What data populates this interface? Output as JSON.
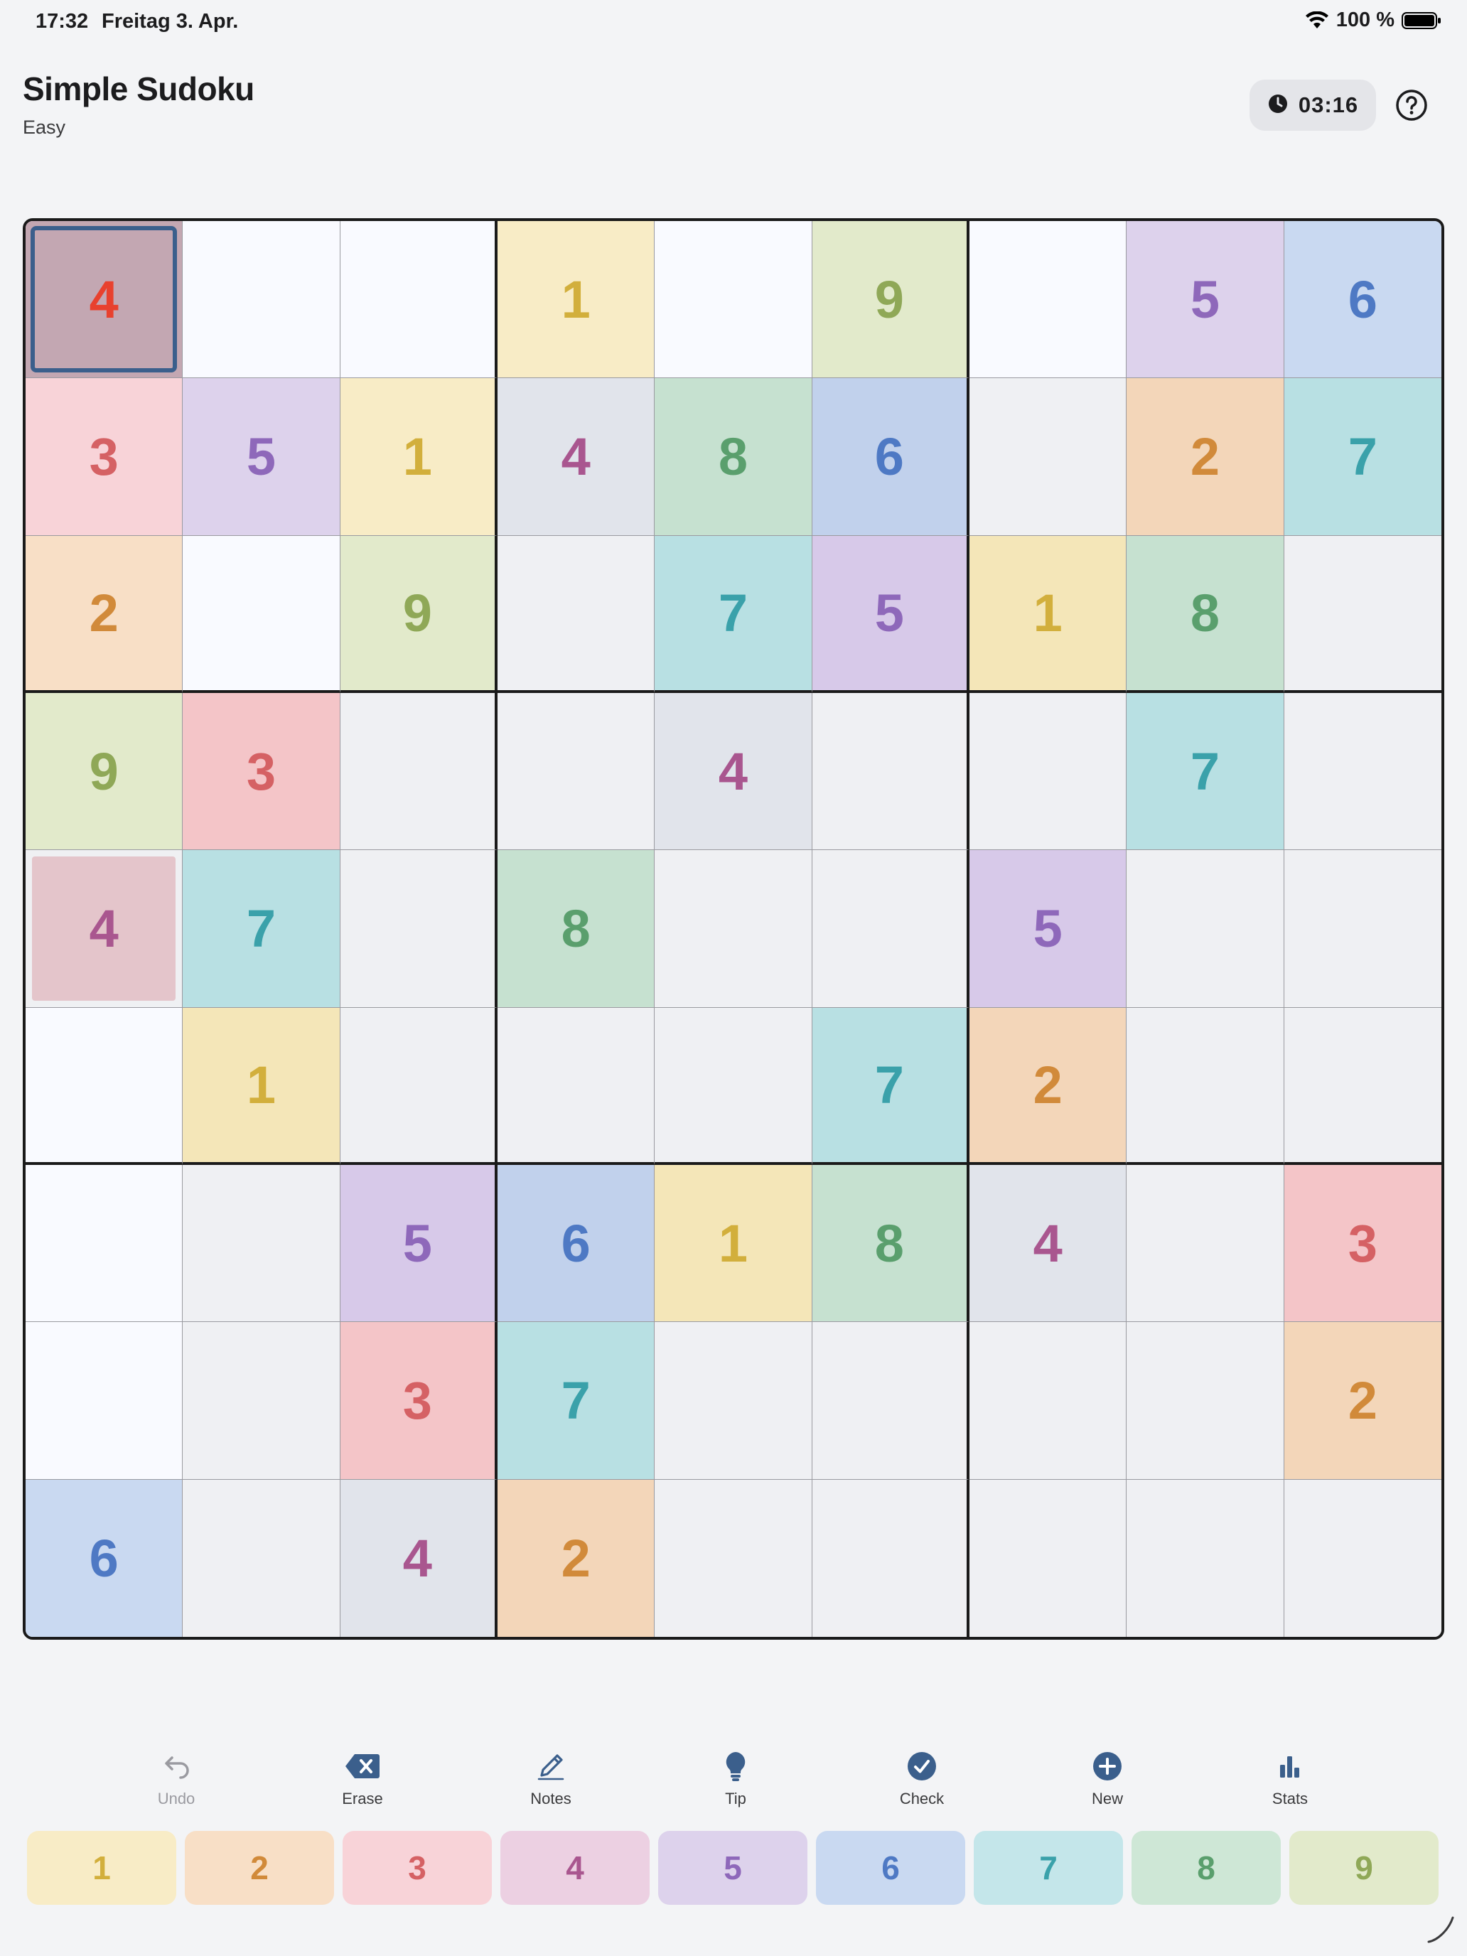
{
  "status_bar": {
    "time": "17:32",
    "date": "Freitag 3. Apr.",
    "battery": "100 %"
  },
  "header": {
    "title": "Simple Sudoku",
    "difficulty": "Easy",
    "timer": "03:16"
  },
  "board": {
    "cells": [
      [
        {
          "v": "4",
          "bg": "#c3a7b2",
          "fg": "#e8412e",
          "selected": true
        },
        {
          "v": "",
          "bg": "#f9faff"
        },
        {
          "v": "",
          "bg": "#f9faff"
        },
        {
          "v": "1",
          "bg": "#f8ecc6",
          "fg": "#d2af3c"
        },
        {
          "v": "",
          "bg": "#f9faff"
        },
        {
          "v": "9",
          "bg": "#e2eacb",
          "fg": "#8fa857"
        },
        {
          "v": "",
          "bg": "#f9faff"
        },
        {
          "v": "5",
          "bg": "#ddd2ec",
          "fg": "#8e68ba"
        },
        {
          "v": "6",
          "bg": "#c9d9f1",
          "fg": "#4e79c4"
        }
      ],
      [
        {
          "v": "3",
          "bg": "#f8d3d8",
          "fg": "#d56164"
        },
        {
          "v": "5",
          "bg": "#ddd2ec",
          "fg": "#8e68ba"
        },
        {
          "v": "1",
          "bg": "#f8ecc6",
          "fg": "#d2af3c"
        },
        {
          "v": "4",
          "bg": "#e1e4eb",
          "fg": "#a9568f"
        },
        {
          "v": "8",
          "bg": "#c6e1d0",
          "fg": "#5a9f6d"
        },
        {
          "v": "6",
          "bg": "#c1d1ec",
          "fg": "#4e79c4"
        },
        {
          "v": "",
          "bg": "#eff0f3"
        },
        {
          "v": "2",
          "bg": "#f3d6b9",
          "fg": "#d18a3a"
        },
        {
          "v": "7",
          "bg": "#b8e0e3",
          "fg": "#3aa1aa"
        }
      ],
      [
        {
          "v": "2",
          "bg": "#f8dfc6",
          "fg": "#d18a3a"
        },
        {
          "v": "",
          "bg": "#f9faff"
        },
        {
          "v": "9",
          "bg": "#e2eacb",
          "fg": "#8fa857"
        },
        {
          "v": "",
          "bg": "#eff0f3"
        },
        {
          "v": "7",
          "bg": "#b8e0e3",
          "fg": "#3aa1aa"
        },
        {
          "v": "5",
          "bg": "#d7c9e9",
          "fg": "#8e68ba"
        },
        {
          "v": "1",
          "bg": "#f4e6b8",
          "fg": "#d2af3c"
        },
        {
          "v": "8",
          "bg": "#c6e1d0",
          "fg": "#5a9f6d"
        },
        {
          "v": "",
          "bg": "#eff0f3"
        }
      ],
      [
        {
          "v": "9",
          "bg": "#e2eacb",
          "fg": "#8fa857"
        },
        {
          "v": "3",
          "bg": "#f4c5c8",
          "fg": "#d56164"
        },
        {
          "v": "",
          "bg": "#eff0f3"
        },
        {
          "v": "",
          "bg": "#eff0f3"
        },
        {
          "v": "4",
          "bg": "#e1e4eb",
          "fg": "#a9568f"
        },
        {
          "v": "",
          "bg": "#eff0f3"
        },
        {
          "v": "",
          "bg": "#eff0f3"
        },
        {
          "v": "7",
          "bg": "#b8e0e3",
          "fg": "#3aa1aa"
        },
        {
          "v": "",
          "bg": "#eff0f3"
        }
      ],
      [
        {
          "v": "4",
          "bg": "#eff0f3",
          "fg": "#a9568f",
          "inner": "#e4c5cb"
        },
        {
          "v": "7",
          "bg": "#b8e0e3",
          "fg": "#3aa1aa"
        },
        {
          "v": "",
          "bg": "#eff0f3"
        },
        {
          "v": "8",
          "bg": "#c6e1d0",
          "fg": "#5a9f6d"
        },
        {
          "v": "",
          "bg": "#eff0f3"
        },
        {
          "v": "",
          "bg": "#eff0f3"
        },
        {
          "v": "5",
          "bg": "#d7c9e9",
          "fg": "#8e68ba"
        },
        {
          "v": "",
          "bg": "#eff0f3"
        },
        {
          "v": "",
          "bg": "#eff0f3"
        }
      ],
      [
        {
          "v": "",
          "bg": "#f9faff"
        },
        {
          "v": "1",
          "bg": "#f4e6b8",
          "fg": "#d2af3c"
        },
        {
          "v": "",
          "bg": "#eff0f3"
        },
        {
          "v": "",
          "bg": "#eff0f3"
        },
        {
          "v": "",
          "bg": "#eff0f3"
        },
        {
          "v": "7",
          "bg": "#b8e0e3",
          "fg": "#3aa1aa"
        },
        {
          "v": "2",
          "bg": "#f3d6b9",
          "fg": "#d18a3a"
        },
        {
          "v": "",
          "bg": "#eff0f3"
        },
        {
          "v": "",
          "bg": "#eff0f3"
        }
      ],
      [
        {
          "v": "",
          "bg": "#f9faff"
        },
        {
          "v": "",
          "bg": "#eff0f3"
        },
        {
          "v": "5",
          "bg": "#d7c9e9",
          "fg": "#8e68ba"
        },
        {
          "v": "6",
          "bg": "#c1d1ec",
          "fg": "#4e79c4"
        },
        {
          "v": "1",
          "bg": "#f4e6b8",
          "fg": "#d2af3c"
        },
        {
          "v": "8",
          "bg": "#c6e1d0",
          "fg": "#5a9f6d"
        },
        {
          "v": "4",
          "bg": "#e1e4eb",
          "fg": "#a9568f"
        },
        {
          "v": "",
          "bg": "#eff0f3"
        },
        {
          "v": "3",
          "bg": "#f4c5c8",
          "fg": "#d56164"
        }
      ],
      [
        {
          "v": "",
          "bg": "#f9faff"
        },
        {
          "v": "",
          "bg": "#eff0f3"
        },
        {
          "v": "3",
          "bg": "#f4c5c8",
          "fg": "#d56164"
        },
        {
          "v": "7",
          "bg": "#b8e0e3",
          "fg": "#3aa1aa"
        },
        {
          "v": "",
          "bg": "#eff0f3"
        },
        {
          "v": "",
          "bg": "#eff0f3"
        },
        {
          "v": "",
          "bg": "#eff0f3"
        },
        {
          "v": "",
          "bg": "#eff0f3"
        },
        {
          "v": "2",
          "bg": "#f3d6b9",
          "fg": "#d18a3a"
        }
      ],
      [
        {
          "v": "6",
          "bg": "#c9d9f1",
          "fg": "#4e79c4"
        },
        {
          "v": "",
          "bg": "#eff0f3"
        },
        {
          "v": "4",
          "bg": "#e1e4eb",
          "fg": "#a9568f"
        },
        {
          "v": "2",
          "bg": "#f3d6b9",
          "fg": "#d18a3a"
        },
        {
          "v": "",
          "bg": "#eff0f3"
        },
        {
          "v": "",
          "bg": "#eff0f3"
        },
        {
          "v": "",
          "bg": "#eff0f3"
        },
        {
          "v": "",
          "bg": "#eff0f3"
        },
        {
          "v": "",
          "bg": "#eff0f3"
        }
      ]
    ]
  },
  "toolbar": [
    {
      "label": "Undo",
      "icon": "undo-icon",
      "disabled": true
    },
    {
      "label": "Erase",
      "icon": "erase-icon"
    },
    {
      "label": "Notes",
      "icon": "pencil-icon"
    },
    {
      "label": "Tip",
      "icon": "lightbulb-icon"
    },
    {
      "label": "Check",
      "icon": "checkmark-circle-icon"
    },
    {
      "label": "New",
      "icon": "plus-circle-icon"
    },
    {
      "label": "Stats",
      "icon": "bar-chart-icon"
    }
  ],
  "numpad": [
    {
      "label": "1",
      "bg": "#f8ecc6",
      "fg": "#d2af3c"
    },
    {
      "label": "2",
      "bg": "#f8dfc6",
      "fg": "#d18a3a"
    },
    {
      "label": "3",
      "bg": "#f8d3d8",
      "fg": "#d56164"
    },
    {
      "label": "4",
      "bg": "#ecd0e2",
      "fg": "#a9568f"
    },
    {
      "label": "5",
      "bg": "#ddd2ec",
      "fg": "#8e68ba"
    },
    {
      "label": "6",
      "bg": "#c9d9f1",
      "fg": "#4e79c4"
    },
    {
      "label": "7",
      "bg": "#c4e6ea",
      "fg": "#3aa1aa"
    },
    {
      "label": "8",
      "bg": "#cee7d6",
      "fg": "#5a9f6d"
    },
    {
      "label": "9",
      "bg": "#e2eacb",
      "fg": "#8fa857"
    }
  ],
  "accent_color": "#3b5f8c"
}
